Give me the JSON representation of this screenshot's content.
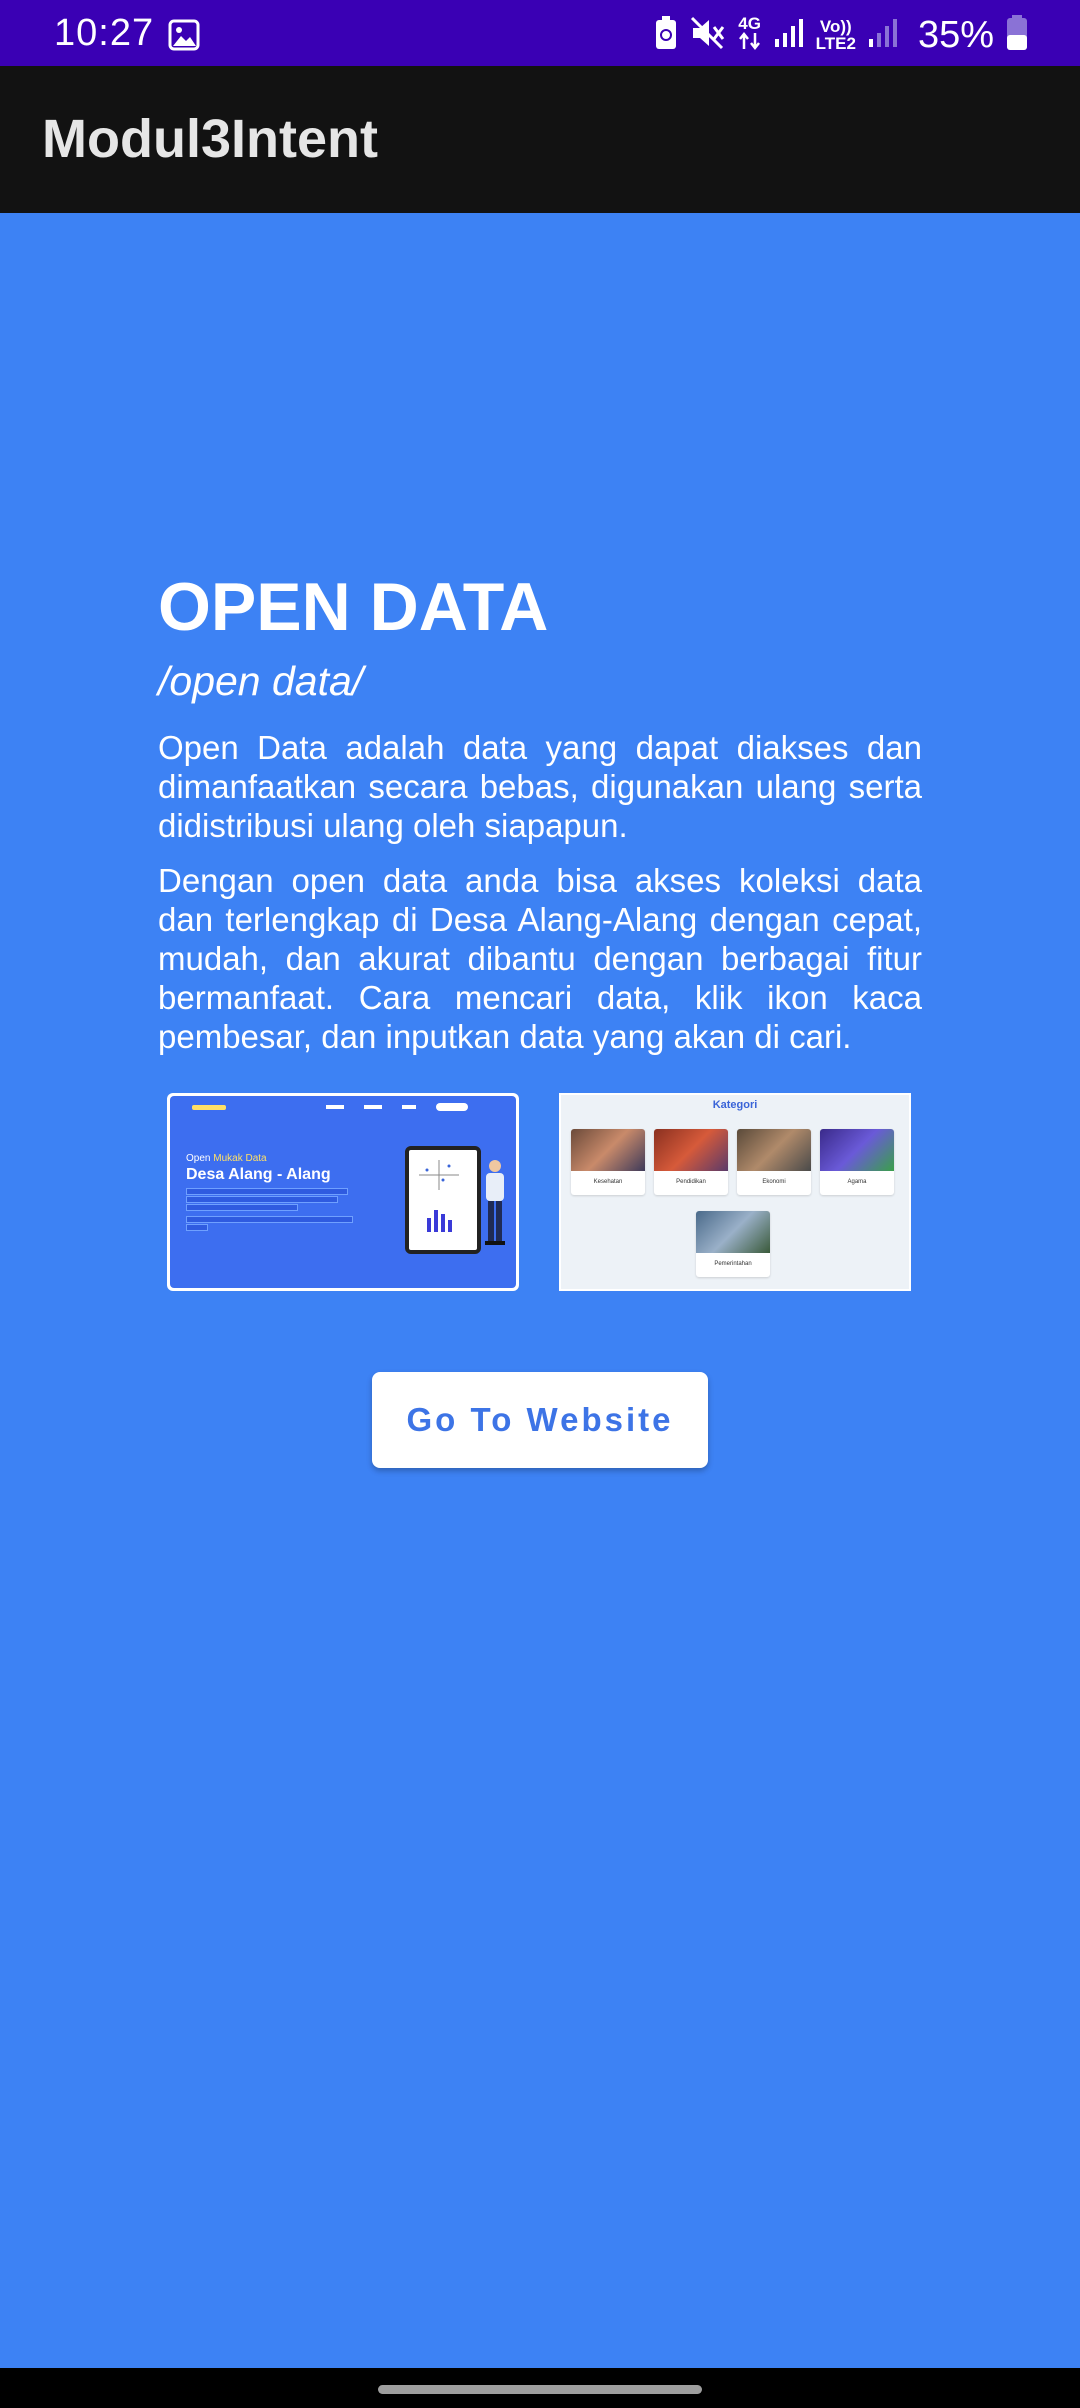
{
  "status_bar": {
    "time": "10:27",
    "network_label": "4G",
    "volte_label": "Vo))",
    "lte_label": "LTE2",
    "battery_percent": "35%",
    "icons": [
      "gallery-icon",
      "battery-saver-icon",
      "mute-icon",
      "data-arrows-icon",
      "signal-icon",
      "signal-weak-icon",
      "battery-icon"
    ]
  },
  "app_bar": {
    "title": "Modul3Intent"
  },
  "content": {
    "heading": "OPEN DATA",
    "phonetic": "/open data/",
    "paragraph1": "Open Data adalah data yang dapat diakses dan dimanfaatkan secara bebas, digunakan ulang serta didistribusi ulang oleh siapapun.",
    "paragraph2": "Dengan open data anda bisa akses koleksi data dan terlengkap di Desa Alang-Alang dengan cepat, mudah, dan akurat dibantu dengan berbagai fitur bermanfaat. Cara mencari data, klik ikon kaca pembesar, dan inputkan data yang akan di cari."
  },
  "screenshot_home": {
    "subtitle_prefix": "Open",
    "subtitle_rest": "Mukak Data",
    "headline": "Desa Alang - Alang"
  },
  "screenshot_categories": {
    "title": "Kategori",
    "categories": [
      "Kesehatan",
      "Pendidikan",
      "Ekonomi",
      "Agama",
      "Pemerintahan"
    ]
  },
  "button": {
    "label": "Go To Website"
  },
  "colors": {
    "status_bar": "#3a00b4",
    "app_bar": "#121212",
    "background": "#3d82f4",
    "button_text": "#3d74e6"
  }
}
